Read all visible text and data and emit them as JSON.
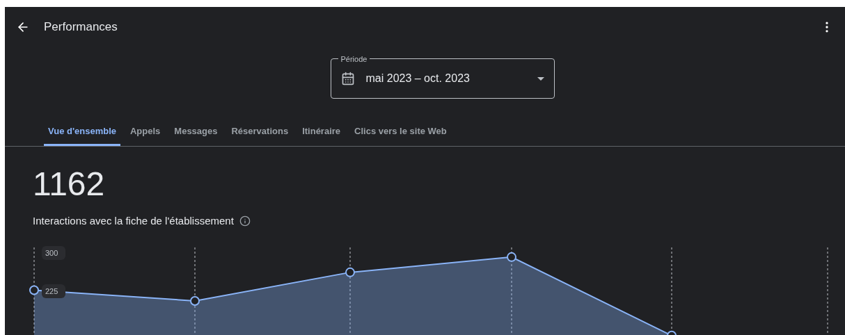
{
  "header": {
    "title": "Performances"
  },
  "period": {
    "label": "Période",
    "value": "mai 2023 – oct. 2023"
  },
  "tabs": [
    {
      "label": "Vue d'ensemble",
      "selected": true
    },
    {
      "label": "Appels",
      "selected": false
    },
    {
      "label": "Messages",
      "selected": false
    },
    {
      "label": "Réservations",
      "selected": false
    },
    {
      "label": "Itinéraire",
      "selected": false
    },
    {
      "label": "Clics vers le site Web",
      "selected": false
    }
  ],
  "summary": {
    "total": "1162",
    "caption": "Interactions avec la fiche de l'établissement"
  },
  "chart": {
    "chart_data": {
      "type": "area",
      "grid": true,
      "ylim": [
        0,
        300
      ],
      "yticks": [
        225,
        300
      ],
      "series": [
        {
          "color": "#8ab4f8",
          "values": [
            227,
            206,
            262,
            292,
            138,
            null
          ]
        }
      ]
    }
  }
}
